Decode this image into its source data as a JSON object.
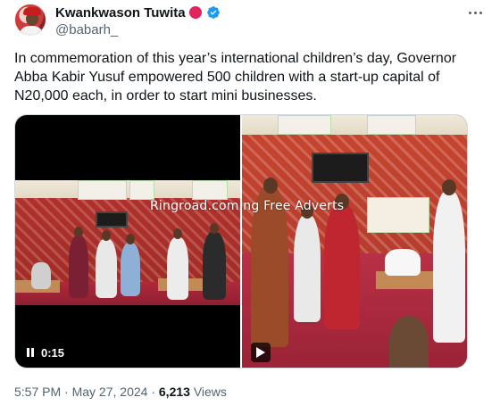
{
  "author": {
    "display_name": "Kwankwason Tuwita",
    "handle": "@babarh_",
    "status_dot_color": "#e0245e",
    "verified_color": "#1d9bf0"
  },
  "tweet": {
    "text": "In commemoration of this year’s international children’s day, Governor Abba Kabir Yusuf empowered 500 children with a start-up capital of N20,000 each, in order to start mini businesses."
  },
  "media": {
    "videos": [
      {
        "control": "pause",
        "time": "0:15"
      },
      {
        "control": "play"
      }
    ],
    "watermark": "Ringroad.com.ng Free Adverts"
  },
  "meta": {
    "time": "5:57 PM",
    "separator": " · ",
    "date": "May 27, 2024",
    "views_count": "6,213",
    "views_label": "Views"
  },
  "icons": {
    "more": "more-horizontal-icon",
    "verified": "verified-badge-icon",
    "pause": "pause-icon",
    "play": "play-icon"
  }
}
